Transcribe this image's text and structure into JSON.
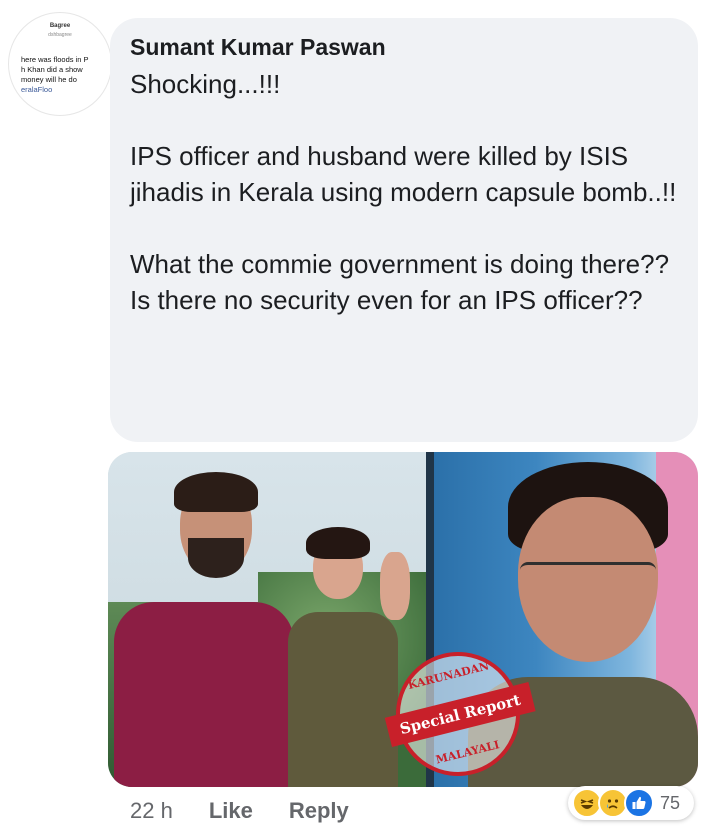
{
  "avatar": {
    "thumbnail_lines": [
      "Bagree",
      "dshbagree",
      "here was floods in P",
      "h Khan did a show",
      "money will he do",
      "eralaFloo"
    ]
  },
  "comment": {
    "author": "Sumant Kumar Paswan",
    "paragraphs": [
      [
        "Shocking...!!!"
      ],
      [
        "IPS officer and husband were killed by ISIS jihadis in Kerala using modern capsule bomb..!!"
      ],
      [
        "What the commie government is doing there??",
        "Is there no security even for an IPS officer??"
      ]
    ]
  },
  "image": {
    "stamp_top": "KARUNADAN",
    "stamp_banner": "Special Report",
    "stamp_bottom": "MALAYALI"
  },
  "footer": {
    "time": "22 h",
    "like_label": "Like",
    "reply_label": "Reply"
  },
  "reactions": {
    "icons": [
      "haha-icon",
      "sad-icon",
      "like-icon"
    ],
    "count": "75"
  },
  "colors": {
    "bubble": "#f0f2f5",
    "meta_text": "#65676b",
    "like_blue": "#1b74e4",
    "stamp_red": "#c8202a"
  }
}
